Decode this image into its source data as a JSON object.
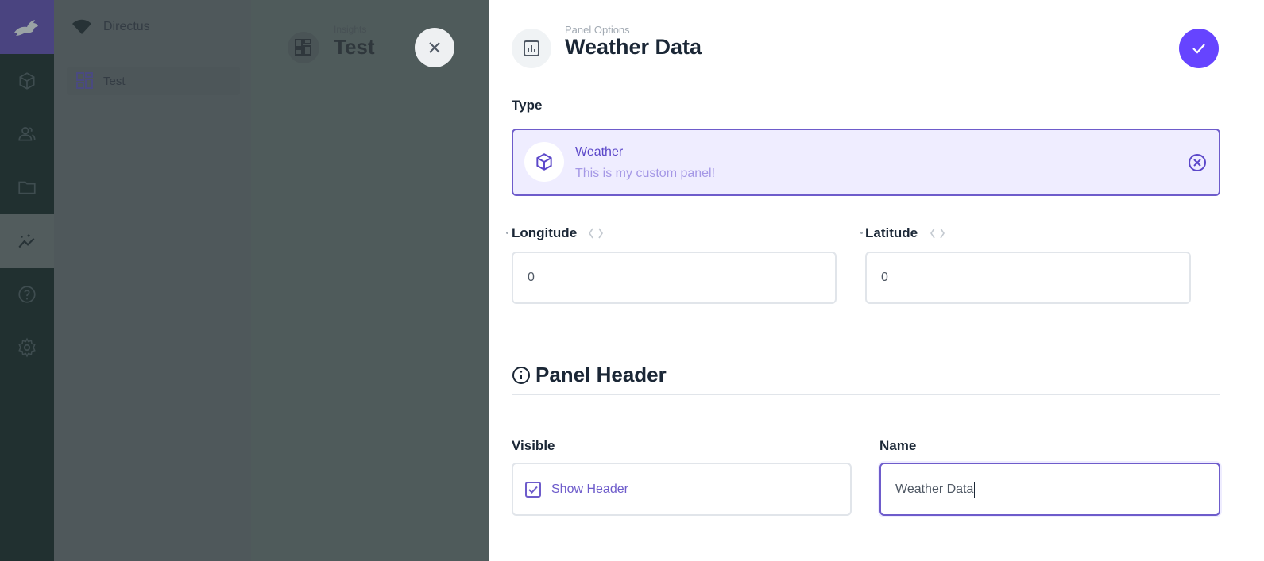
{
  "app": {
    "project_name": "Directus",
    "module_bar": {
      "items": [
        {
          "id": "content",
          "icon": "cube-icon"
        },
        {
          "id": "users",
          "icon": "users-icon"
        },
        {
          "id": "files",
          "icon": "folder-icon"
        },
        {
          "id": "insights",
          "icon": "insights-icon",
          "active": true
        },
        {
          "id": "help",
          "icon": "help-icon"
        },
        {
          "id": "settings",
          "icon": "gear-icon"
        }
      ]
    },
    "nav": {
      "items": [
        {
          "label": "Test",
          "icon": "dashboard-icon"
        }
      ]
    },
    "header": {
      "breadcrumb": "Insights",
      "title": "Test"
    }
  },
  "drawer": {
    "breadcrumb": "Panel Options",
    "title": "Weather Data",
    "type": {
      "label": "Type",
      "selected_name": "Weather",
      "selected_description": "This is my custom panel!"
    },
    "fields": {
      "longitude": {
        "label": "Longitude",
        "value": "0",
        "required": true
      },
      "latitude": {
        "label": "Latitude",
        "value": "0",
        "required": true
      }
    },
    "panel_header": {
      "section_title": "Panel Header",
      "visible": {
        "label": "Visible",
        "checkbox_label": "Show Header",
        "checked": true
      },
      "name": {
        "label": "Name",
        "value": "Weather Data"
      }
    }
  },
  "colors": {
    "accent": "#6644ff",
    "accent_light": "#efedff",
    "text_dark": "#1b2736"
  }
}
